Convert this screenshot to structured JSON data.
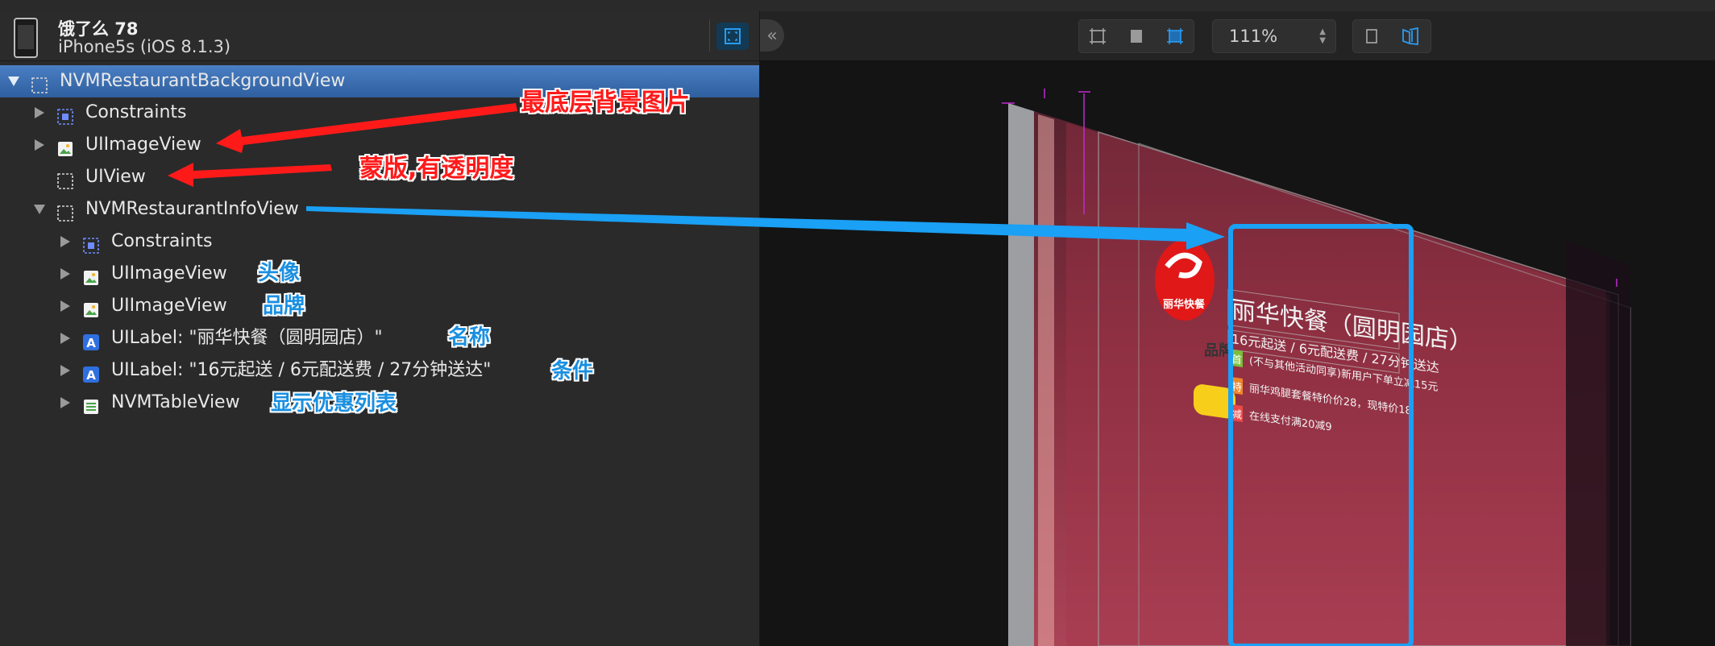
{
  "device": {
    "title": "饿了么 78",
    "subtitle": "iPhone5s (iOS 8.1.3)"
  },
  "zoom": {
    "value": "111%"
  },
  "tree": [
    {
      "label": "NVMRestaurantBackgroundView",
      "icon": "view-icon",
      "depth": 0,
      "expanded": true,
      "selected": true
    },
    {
      "label": "Constraints",
      "icon": "constraints-icon",
      "depth": 1,
      "expanded": false
    },
    {
      "label": "UIImageView",
      "icon": "image-icon",
      "depth": 1,
      "expanded": false
    },
    {
      "label": "UIView",
      "icon": "view-icon",
      "depth": 1,
      "expanded": null
    },
    {
      "label": "NVMRestaurantInfoView",
      "icon": "view-icon",
      "depth": 1,
      "expanded": true
    },
    {
      "label": "Constraints",
      "icon": "constraints-icon",
      "depth": 2,
      "expanded": false
    },
    {
      "label": "UIImageView",
      "icon": "image-icon",
      "depth": 2,
      "expanded": false
    },
    {
      "label": "UIImageView",
      "icon": "image-icon",
      "depth": 2,
      "expanded": false
    },
    {
      "label": "UILabel: \"丽华快餐（圆明园店）\"",
      "icon": "label-icon",
      "depth": 2,
      "expanded": false
    },
    {
      "label": "UILabel: \"16元起送 / 6元配送费 / 27分钟送达\"",
      "icon": "label-icon",
      "depth": 2,
      "expanded": false
    },
    {
      "label": "NVMTableView",
      "icon": "table-icon",
      "depth": 2,
      "expanded": false
    }
  ],
  "annotations": {
    "bottom_bg": "最底层背景图片",
    "mask": "蒙版,有透明度",
    "avatar": "头像",
    "brand": "品牌",
    "name": "名称",
    "condition": "条件",
    "discounts": "显示优惠列表"
  },
  "preview": {
    "logo_text": "丽华快餐",
    "brand_badge": "品牌",
    "restaurant_name": "丽华快餐（圆明园店）",
    "delivery_info": "16元起送 / 6元配送费 / 27分钟送达",
    "promos": [
      {
        "tag": "首",
        "text": "(不与其他活动同享)新用户下单立减15元",
        "color": "#7bbf3a"
      },
      {
        "tag": "特",
        "text": "丽华鸡腿套餐特价价28，现特价18",
        "color": "#f0862a"
      },
      {
        "tag": "减",
        "text": "在线支付满20减9",
        "color": "#e84a4a"
      }
    ]
  }
}
